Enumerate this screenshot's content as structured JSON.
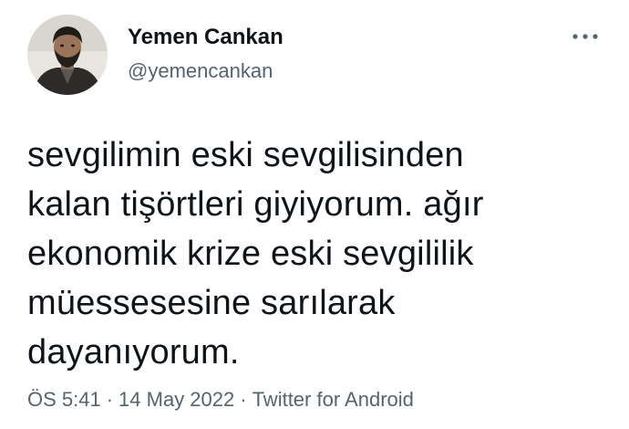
{
  "author": {
    "display_name": "Yemen Cankan",
    "handle": "@yemencankan",
    "avatar_icon": "profile-photo"
  },
  "menu": {
    "icon": "more-horizontal-icon"
  },
  "tweet": {
    "text": "sevgilimin eski sevgilisinden\nkalan tişörtleri giyiyorum. ağır\nekonomik krize eski sevgililik\nmüessesesine sarılarak\ndayanıyorum."
  },
  "meta": {
    "time": "ÖS 5:41",
    "separator": "·",
    "date": "14 May 2022",
    "source": "Twitter for Android"
  },
  "colors": {
    "text_primary": "#0f1419",
    "text_secondary": "#536471",
    "background": "#ffffff"
  }
}
